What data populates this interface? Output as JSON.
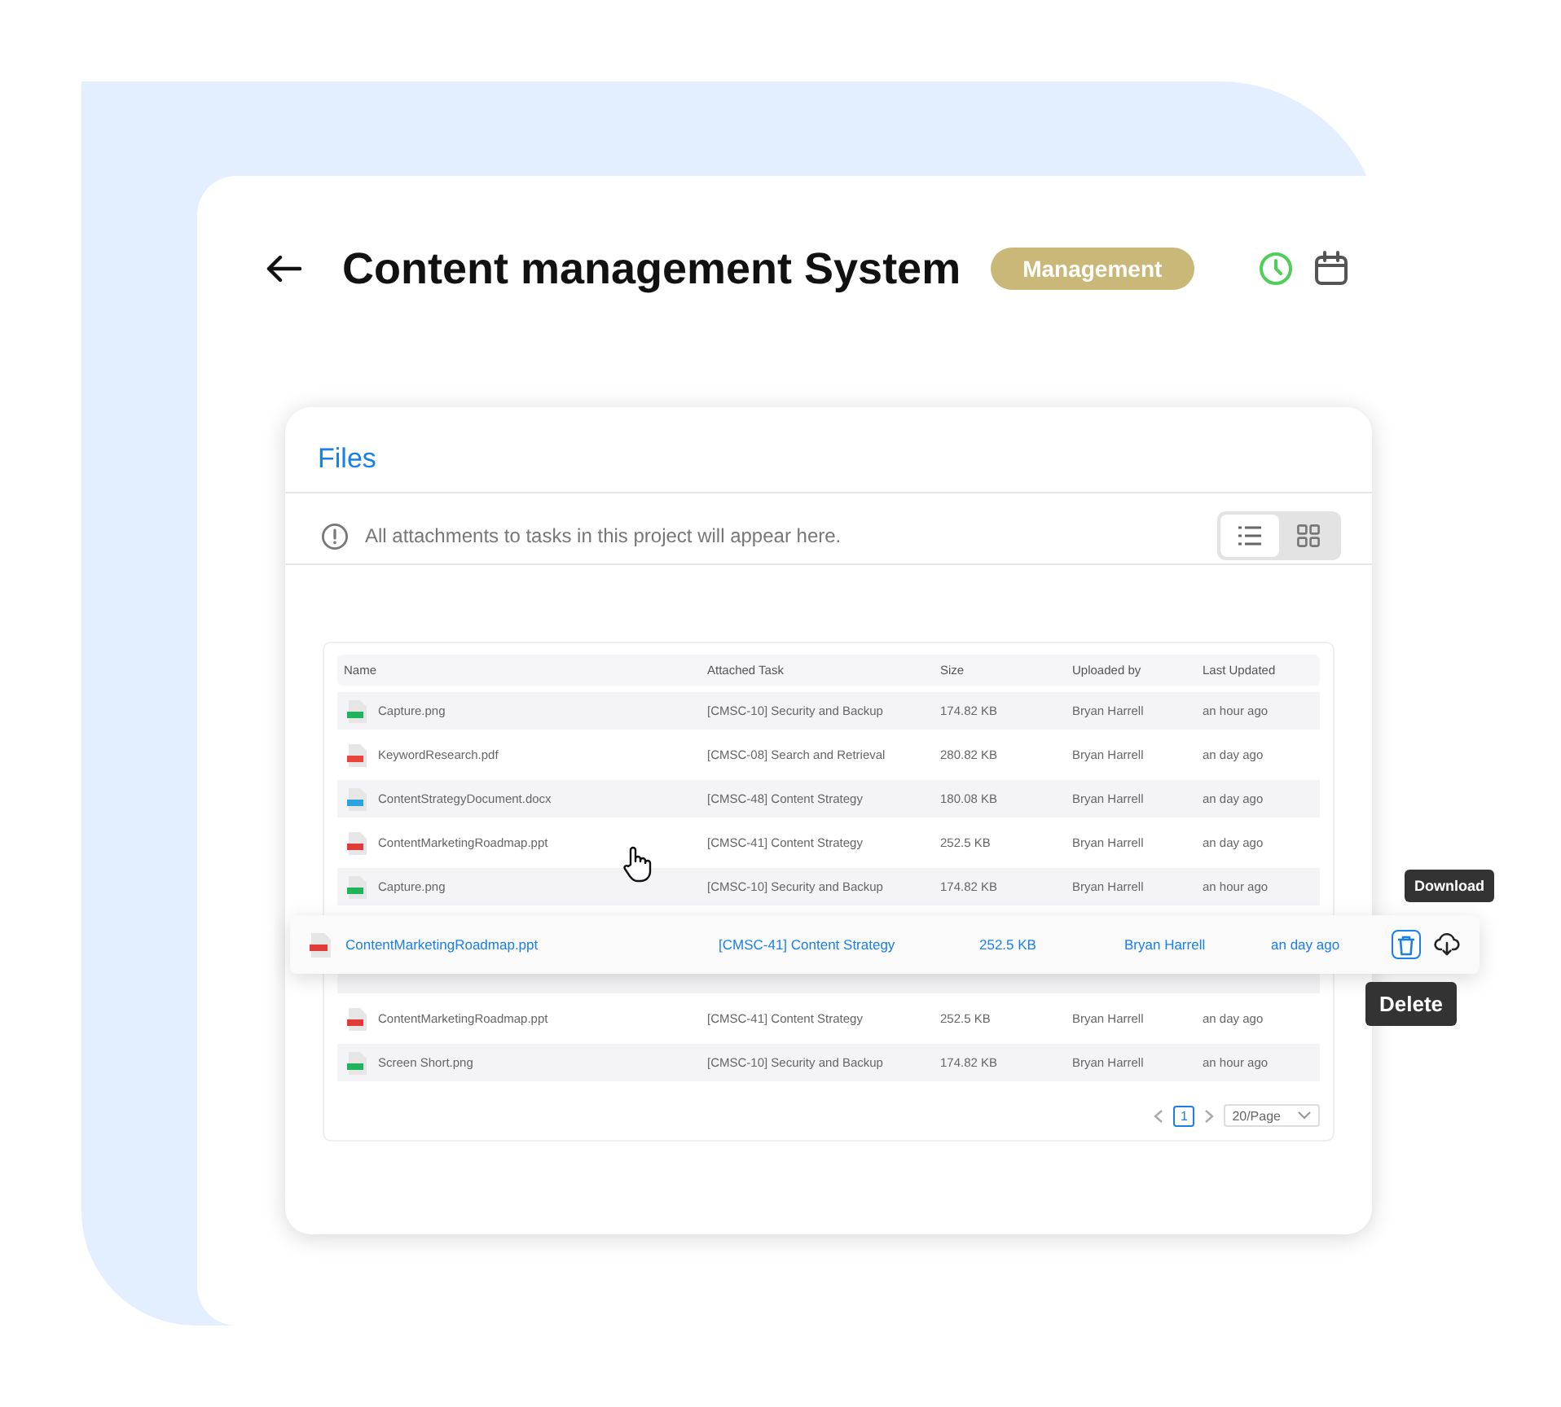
{
  "title": "Content management System",
  "badge": "Management",
  "files": {
    "title": "Files",
    "notice": "All attachments to tasks in this project will appear here.",
    "view_toggle": [
      {
        "kind": "list",
        "selected": true
      },
      {
        "kind": "grid",
        "selected": false
      }
    ],
    "table": {
      "columns": [
        "Name",
        "Attached Task",
        "Size",
        "Uploaded by",
        "Last Updated"
      ],
      "rows": [
        {
          "kind": "png",
          "name": "Capture.png",
          "task": "[CMSC-10] Security and Backup",
          "size": "174.82 KB",
          "uploaded_by": "Bryan Harrell",
          "updated": "an hour ago"
        },
        {
          "kind": "pdf",
          "name": "KeywordResearch.pdf",
          "task": "[CMSC-08] Search and Retrieval",
          "size": "280.82 KB",
          "uploaded_by": "Bryan Harrell",
          "updated": "an day ago"
        },
        {
          "kind": "docx",
          "name": "ContentStrategyDocument.docx",
          "task": "[CMSC-48] Content Strategy",
          "size": "180.08 KB",
          "uploaded_by": "Bryan Harrell",
          "updated": "an day ago"
        },
        {
          "kind": "ppt",
          "name": "ContentMarketingRoadmap.ppt",
          "task": "[CMSC-41] Content Strategy",
          "size": "252.5 KB",
          "uploaded_by": "Bryan Harrell",
          "updated": "an day ago"
        },
        {
          "kind": "png",
          "name": "Capture.png",
          "task": "[CMSC-10] Security and Backup",
          "size": "174.82 KB",
          "uploaded_by": "Bryan Harrell",
          "updated": "an hour ago"
        },
        {
          "kind": "ppt",
          "name": "ContentMarketingRoadmap.ppt",
          "task": "[CMSC-41] Content Strategy",
          "size": "252.5 KB",
          "uploaded_by": "Bryan Harrell",
          "updated": "an day ago"
        },
        {
          "kind": "png",
          "name": "Screen Short.png",
          "task": "[CMSC-10] Security and Backup",
          "size": "174.82 KB",
          "uploaded_by": "Bryan Harrell",
          "updated": "an hour ago"
        }
      ]
    },
    "pagination": {
      "pages": [
        {
          "label": "1",
          "selected": true
        }
      ],
      "page_size": "20/Page"
    }
  },
  "dragged_row": {
    "kind": "ppt",
    "name": "ContentMarketingRoadmap.ppt",
    "task": "[CMSC-41] Content Strategy",
    "size": "252.5 KB",
    "uploaded_by": "Bryan Harrell",
    "updated": "an day ago",
    "actions": [
      {
        "kind": "delete",
        "tooltip": "Delete",
        "selected": true
      },
      {
        "kind": "download",
        "tooltip": "Download",
        "selected": false
      }
    ]
  }
}
